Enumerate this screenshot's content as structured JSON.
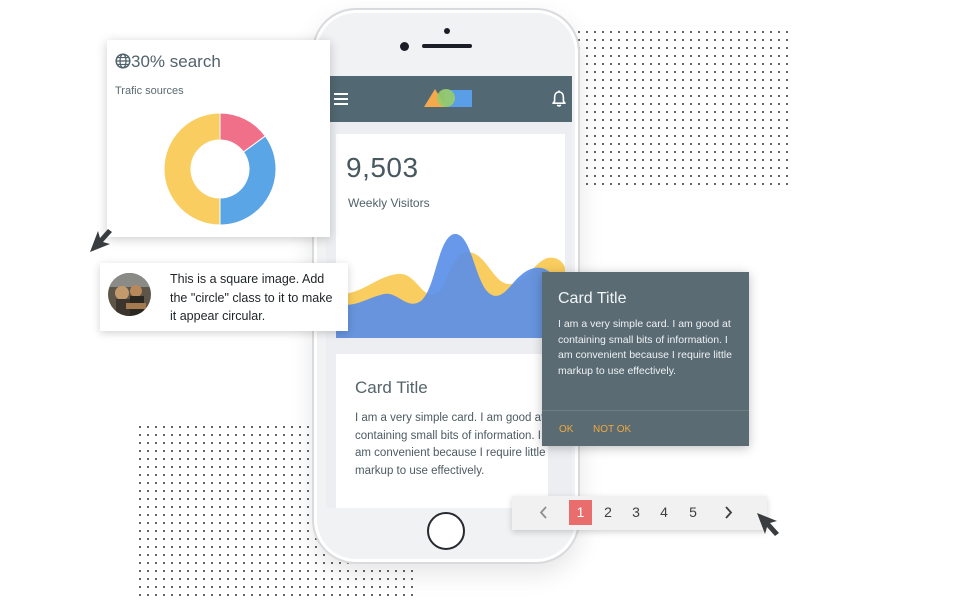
{
  "traffic": {
    "title": "30% search",
    "subtitle": "Trafic sources",
    "icon": "globe-icon",
    "chart_data": {
      "type": "pie",
      "categories": [
        "",
        "",
        ""
      ],
      "values": [
        15,
        35,
        50
      ],
      "colors": [
        "#f07089",
        "#5aa5e6",
        "#f9cd5f"
      ]
    }
  },
  "app": {
    "menu_icon": "menu-icon",
    "bell_icon": "bell-icon",
    "header_color": "#526872",
    "stats": {
      "value": "9,503",
      "label": "Weekly Visitors"
    },
    "card_title": "Card Title",
    "card_body": "I am a very simple card. I am good at containing small bits of information. I am convenient because I require little markup to use effectively."
  },
  "avatar_item": {
    "text": "This is a square image. Add the \"circle\" class to it to make it appear circular."
  },
  "dark_card": {
    "title": "Card Title",
    "body": "I am a very simple card. I am good at containing small bits of information. I am convenient because I require little markup to use effectively.",
    "ok_label": "OK",
    "not_ok_label": "NOT OK",
    "background": "#5a6b74",
    "action_color": "#f0a93d"
  },
  "pagination": {
    "prev_icon": "chevron-left-icon",
    "next_icon": "chevron-right-icon",
    "pages": [
      "1",
      "2",
      "3",
      "4",
      "5"
    ],
    "active_page": "1",
    "active_color": "#e86d6c"
  },
  "colors": {
    "yellow": "#f9cd5f",
    "blue": "#5a8fe8",
    "pink": "#f07089"
  }
}
